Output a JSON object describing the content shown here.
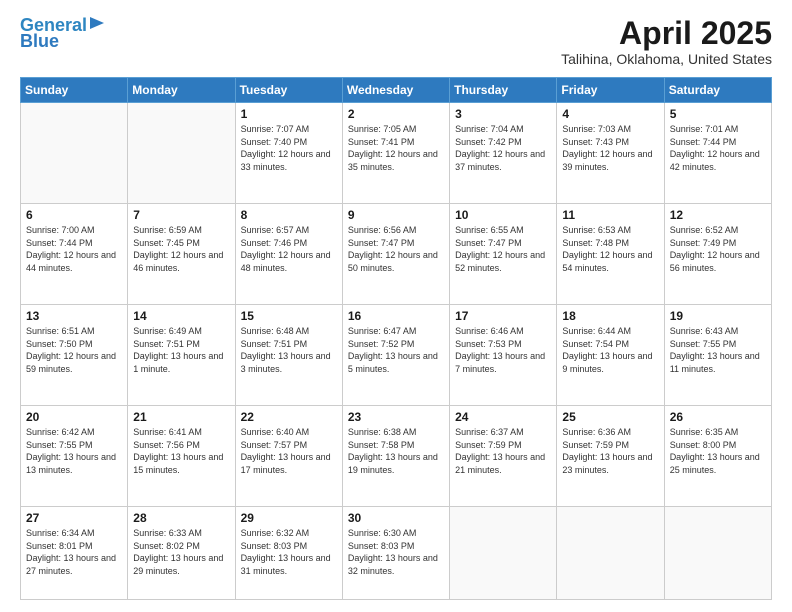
{
  "logo": {
    "line1": "General",
    "line2": "Blue"
  },
  "header": {
    "title": "April 2025",
    "subtitle": "Talihina, Oklahoma, United States"
  },
  "days_of_week": [
    "Sunday",
    "Monday",
    "Tuesday",
    "Wednesday",
    "Thursday",
    "Friday",
    "Saturday"
  ],
  "weeks": [
    [
      {
        "num": "",
        "info": ""
      },
      {
        "num": "",
        "info": ""
      },
      {
        "num": "1",
        "info": "Sunrise: 7:07 AM\nSunset: 7:40 PM\nDaylight: 12 hours and 33 minutes."
      },
      {
        "num": "2",
        "info": "Sunrise: 7:05 AM\nSunset: 7:41 PM\nDaylight: 12 hours and 35 minutes."
      },
      {
        "num": "3",
        "info": "Sunrise: 7:04 AM\nSunset: 7:42 PM\nDaylight: 12 hours and 37 minutes."
      },
      {
        "num": "4",
        "info": "Sunrise: 7:03 AM\nSunset: 7:43 PM\nDaylight: 12 hours and 39 minutes."
      },
      {
        "num": "5",
        "info": "Sunrise: 7:01 AM\nSunset: 7:44 PM\nDaylight: 12 hours and 42 minutes."
      }
    ],
    [
      {
        "num": "6",
        "info": "Sunrise: 7:00 AM\nSunset: 7:44 PM\nDaylight: 12 hours and 44 minutes."
      },
      {
        "num": "7",
        "info": "Sunrise: 6:59 AM\nSunset: 7:45 PM\nDaylight: 12 hours and 46 minutes."
      },
      {
        "num": "8",
        "info": "Sunrise: 6:57 AM\nSunset: 7:46 PM\nDaylight: 12 hours and 48 minutes."
      },
      {
        "num": "9",
        "info": "Sunrise: 6:56 AM\nSunset: 7:47 PM\nDaylight: 12 hours and 50 minutes."
      },
      {
        "num": "10",
        "info": "Sunrise: 6:55 AM\nSunset: 7:47 PM\nDaylight: 12 hours and 52 minutes."
      },
      {
        "num": "11",
        "info": "Sunrise: 6:53 AM\nSunset: 7:48 PM\nDaylight: 12 hours and 54 minutes."
      },
      {
        "num": "12",
        "info": "Sunrise: 6:52 AM\nSunset: 7:49 PM\nDaylight: 12 hours and 56 minutes."
      }
    ],
    [
      {
        "num": "13",
        "info": "Sunrise: 6:51 AM\nSunset: 7:50 PM\nDaylight: 12 hours and 59 minutes."
      },
      {
        "num": "14",
        "info": "Sunrise: 6:49 AM\nSunset: 7:51 PM\nDaylight: 13 hours and 1 minute."
      },
      {
        "num": "15",
        "info": "Sunrise: 6:48 AM\nSunset: 7:51 PM\nDaylight: 13 hours and 3 minutes."
      },
      {
        "num": "16",
        "info": "Sunrise: 6:47 AM\nSunset: 7:52 PM\nDaylight: 13 hours and 5 minutes."
      },
      {
        "num": "17",
        "info": "Sunrise: 6:46 AM\nSunset: 7:53 PM\nDaylight: 13 hours and 7 minutes."
      },
      {
        "num": "18",
        "info": "Sunrise: 6:44 AM\nSunset: 7:54 PM\nDaylight: 13 hours and 9 minutes."
      },
      {
        "num": "19",
        "info": "Sunrise: 6:43 AM\nSunset: 7:55 PM\nDaylight: 13 hours and 11 minutes."
      }
    ],
    [
      {
        "num": "20",
        "info": "Sunrise: 6:42 AM\nSunset: 7:55 PM\nDaylight: 13 hours and 13 minutes."
      },
      {
        "num": "21",
        "info": "Sunrise: 6:41 AM\nSunset: 7:56 PM\nDaylight: 13 hours and 15 minutes."
      },
      {
        "num": "22",
        "info": "Sunrise: 6:40 AM\nSunset: 7:57 PM\nDaylight: 13 hours and 17 minutes."
      },
      {
        "num": "23",
        "info": "Sunrise: 6:38 AM\nSunset: 7:58 PM\nDaylight: 13 hours and 19 minutes."
      },
      {
        "num": "24",
        "info": "Sunrise: 6:37 AM\nSunset: 7:59 PM\nDaylight: 13 hours and 21 minutes."
      },
      {
        "num": "25",
        "info": "Sunrise: 6:36 AM\nSunset: 7:59 PM\nDaylight: 13 hours and 23 minutes."
      },
      {
        "num": "26",
        "info": "Sunrise: 6:35 AM\nSunset: 8:00 PM\nDaylight: 13 hours and 25 minutes."
      }
    ],
    [
      {
        "num": "27",
        "info": "Sunrise: 6:34 AM\nSunset: 8:01 PM\nDaylight: 13 hours and 27 minutes."
      },
      {
        "num": "28",
        "info": "Sunrise: 6:33 AM\nSunset: 8:02 PM\nDaylight: 13 hours and 29 minutes."
      },
      {
        "num": "29",
        "info": "Sunrise: 6:32 AM\nSunset: 8:03 PM\nDaylight: 13 hours and 31 minutes."
      },
      {
        "num": "30",
        "info": "Sunrise: 6:30 AM\nSunset: 8:03 PM\nDaylight: 13 hours and 32 minutes."
      },
      {
        "num": "",
        "info": ""
      },
      {
        "num": "",
        "info": ""
      },
      {
        "num": "",
        "info": ""
      }
    ]
  ]
}
